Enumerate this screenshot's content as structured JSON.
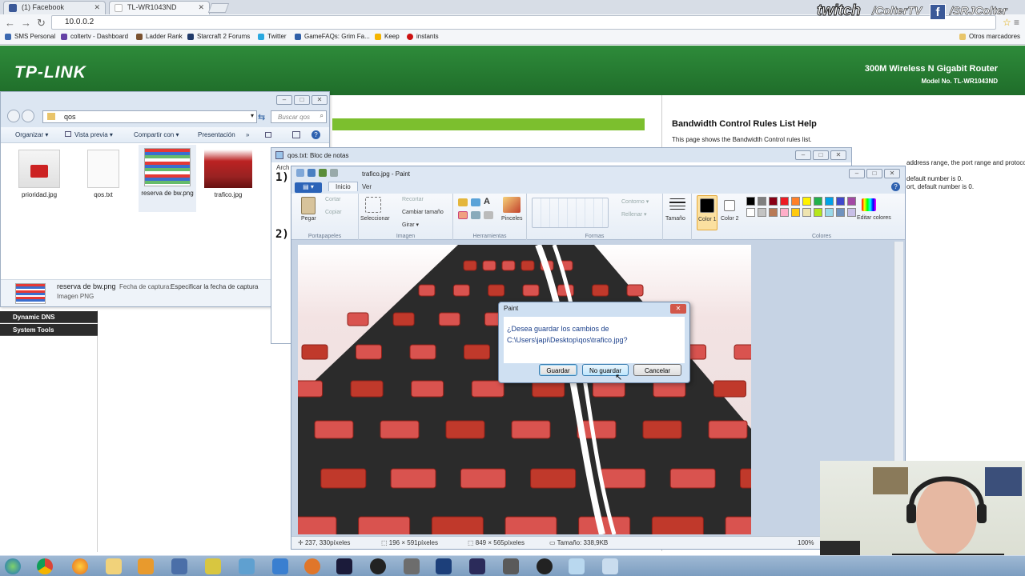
{
  "browser": {
    "tabs": [
      {
        "label": "(1) Facebook",
        "color": "#3b5998"
      },
      {
        "label": "TL-WR1043ND",
        "color": "#2e8b3a"
      }
    ],
    "url": "10.0.0.2",
    "bookmarks": [
      {
        "label": "SMS Personal",
        "color": "#3b68b0"
      },
      {
        "label": "coltertv - Dashboard",
        "color": "#6441a5"
      },
      {
        "label": "Ladder Rank",
        "color": "#7a5230"
      },
      {
        "label": "Starcraft 2 Forums",
        "color": "#203a6a"
      },
      {
        "label": "Twitter",
        "color": "#2aa9e0"
      },
      {
        "label": "GameFAQs: Grim Fa...",
        "color": "#2e5fa8"
      },
      {
        "label": "Keep",
        "color": "#f4b400"
      },
      {
        "label": "instants",
        "color": "#cc1111"
      }
    ],
    "other_bookmarks": "Otros marcadores"
  },
  "router": {
    "logo": "TP-LINK",
    "model_line": "300M Wireless N Gigabit Router",
    "model_no": "Model No. TL-WR1043ND",
    "help_title": "Bandwidth Control Rules List Help",
    "help_text": "This page shows the Bandwidth Control rules list.",
    "help_frag1": "address range, the port range and protocol of transport",
    "help_frag2": "default number is 0.",
    "help_frag3": "ort, default number is 0.",
    "menu": [
      "Dynamic DNS",
      "System Tools"
    ]
  },
  "explorer": {
    "path": "qos",
    "search_placeholder": "Buscar qos",
    "toolbar": [
      "Organizar ▾",
      "Vista previa ▾",
      "Compartir con ▾",
      "Presentación",
      "»"
    ],
    "files": [
      {
        "name": "prioridad.jpg"
      },
      {
        "name": "qos.txt"
      },
      {
        "name": "reserva de bw.png"
      },
      {
        "name": "trafico.jpg"
      }
    ],
    "details": {
      "filename": "reserva de bw.png",
      "capture_label": "Fecha de captura:",
      "capture_value": "Especificar la fecha de captura",
      "type": "Imagen PNG"
    }
  },
  "notepad": {
    "title": "qos.txt: Bloc de notas",
    "menu": "Arch",
    "lines": [
      "1)",
      "2)"
    ]
  },
  "paint": {
    "title": "trafico.jpg - Paint",
    "tabs": [
      "Inicio",
      "Ver"
    ],
    "ribbon": {
      "portapapeles": {
        "label": "Portapapeles",
        "paste": "Pegar",
        "cut": "Cortar",
        "copy": "Copiar"
      },
      "imagen": {
        "label": "Imagen",
        "select": "Seleccionar",
        "crop": "Recortar",
        "resize": "Cambiar tamaño",
        "rotate": "Girar ▾"
      },
      "herramientas": {
        "label": "Herramientas",
        "brushes": "Pinceles"
      },
      "formas": {
        "label": "Formas",
        "outline": "Contorno ▾",
        "fill": "Rellenar ▾"
      },
      "size": "Tamaño",
      "color1": "Color 1",
      "color2": "Color 2",
      "edit_colors": "Editar colores",
      "colores": {
        "label": "Colores"
      }
    },
    "palette": [
      "#000000",
      "#7f7f7f",
      "#880015",
      "#ed1c24",
      "#ff7f27",
      "#fff200",
      "#22b14c",
      "#00a2e8",
      "#3f48cc",
      "#a349a4",
      "#ffffff",
      "#c3c3c3",
      "#b97a57",
      "#ffaec9",
      "#ffc90e",
      "#efe4b0",
      "#b5e61d",
      "#99d9ea",
      "#7092be",
      "#c8bfe7"
    ],
    "status": {
      "cursor": "237, 330píxeles",
      "selection": "196 × 591píxeles",
      "image_size": "849 × 565píxeles",
      "file_size": "Tamaño: 338,9KB",
      "zoom": "100%"
    }
  },
  "dialog": {
    "title": "Paint",
    "message_line1": "¿Desea guardar los cambios de",
    "message_line2": "C:\\Users\\japi\\Desktop\\qos\\trafico.jpg?",
    "buttons": {
      "save": "Guardar",
      "dont_save": "No guardar",
      "cancel": "Cancelar"
    }
  },
  "overlay": {
    "twitch": "twitch",
    "twitch_handle": "/ColterTV",
    "facebook_handle": "/SRJColter"
  }
}
